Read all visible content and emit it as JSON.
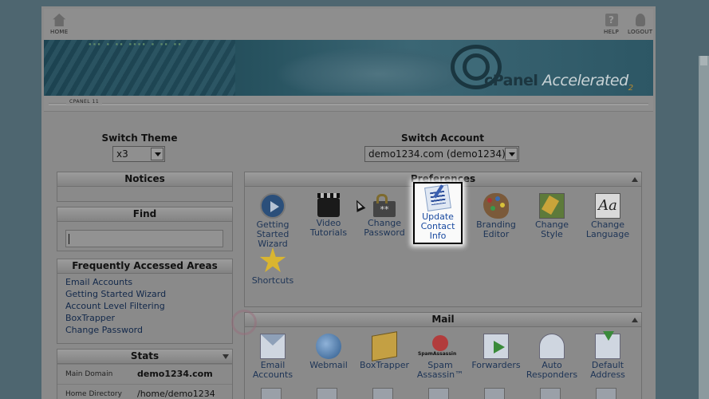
{
  "topbar": {
    "home_label": "HOME",
    "help_label": "HELP",
    "logout_label": "LOGOUT"
  },
  "banner": {
    "brand_prefix": "cPanel",
    "brand_suffix": "Accelerated",
    "brand_version": "2"
  },
  "subbar": {
    "tag": "CPANEL 11"
  },
  "switch_theme": {
    "label": "Switch Theme",
    "value": "x3"
  },
  "switch_account": {
    "label": "Switch Account",
    "value": "demo1234.com (demo1234)"
  },
  "notices": {
    "title": "Notices"
  },
  "find": {
    "title": "Find",
    "value": ""
  },
  "frequently_accessed": {
    "title": "Frequently Accessed Areas",
    "items": [
      "Email Accounts",
      "Getting Started Wizard",
      "Account Level Filtering",
      "BoxTrapper",
      "Change Password"
    ]
  },
  "stats": {
    "title": "Stats",
    "rows": [
      {
        "key": "Main Domain",
        "value": "demo1234.com"
      },
      {
        "key": "Home Directory",
        "value": "/home/demo1234"
      }
    ]
  },
  "preferences": {
    "title": "Preferences",
    "items": [
      {
        "label1": "Getting",
        "label2": "Started",
        "label3": "Wizard"
      },
      {
        "label1": "Video",
        "label2": "Tutorials",
        "label3": ""
      },
      {
        "label1": "Change",
        "label2": "Password",
        "label3": ""
      },
      {
        "label1": "Update",
        "label2": "Contact",
        "label3": "Info"
      },
      {
        "label1": "Branding",
        "label2": "Editor",
        "label3": ""
      },
      {
        "label1": "Change",
        "label2": "Style",
        "label3": ""
      },
      {
        "label1": "Change",
        "label2": "Language",
        "label3": ""
      },
      {
        "label1": "Shortcuts",
        "label2": "",
        "label3": ""
      }
    ]
  },
  "mail": {
    "title": "Mail",
    "items": [
      {
        "label1": "Email",
        "label2": "Accounts"
      },
      {
        "label1": "Webmail",
        "label2": ""
      },
      {
        "label1": "BoxTrapper",
        "label2": ""
      },
      {
        "label1": "Spam",
        "label2": "Assassin™"
      },
      {
        "label1": "Forwarders",
        "label2": ""
      },
      {
        "label1": "Auto",
        "label2": "Responders"
      },
      {
        "label1": "Default",
        "label2": "Address"
      }
    ]
  }
}
